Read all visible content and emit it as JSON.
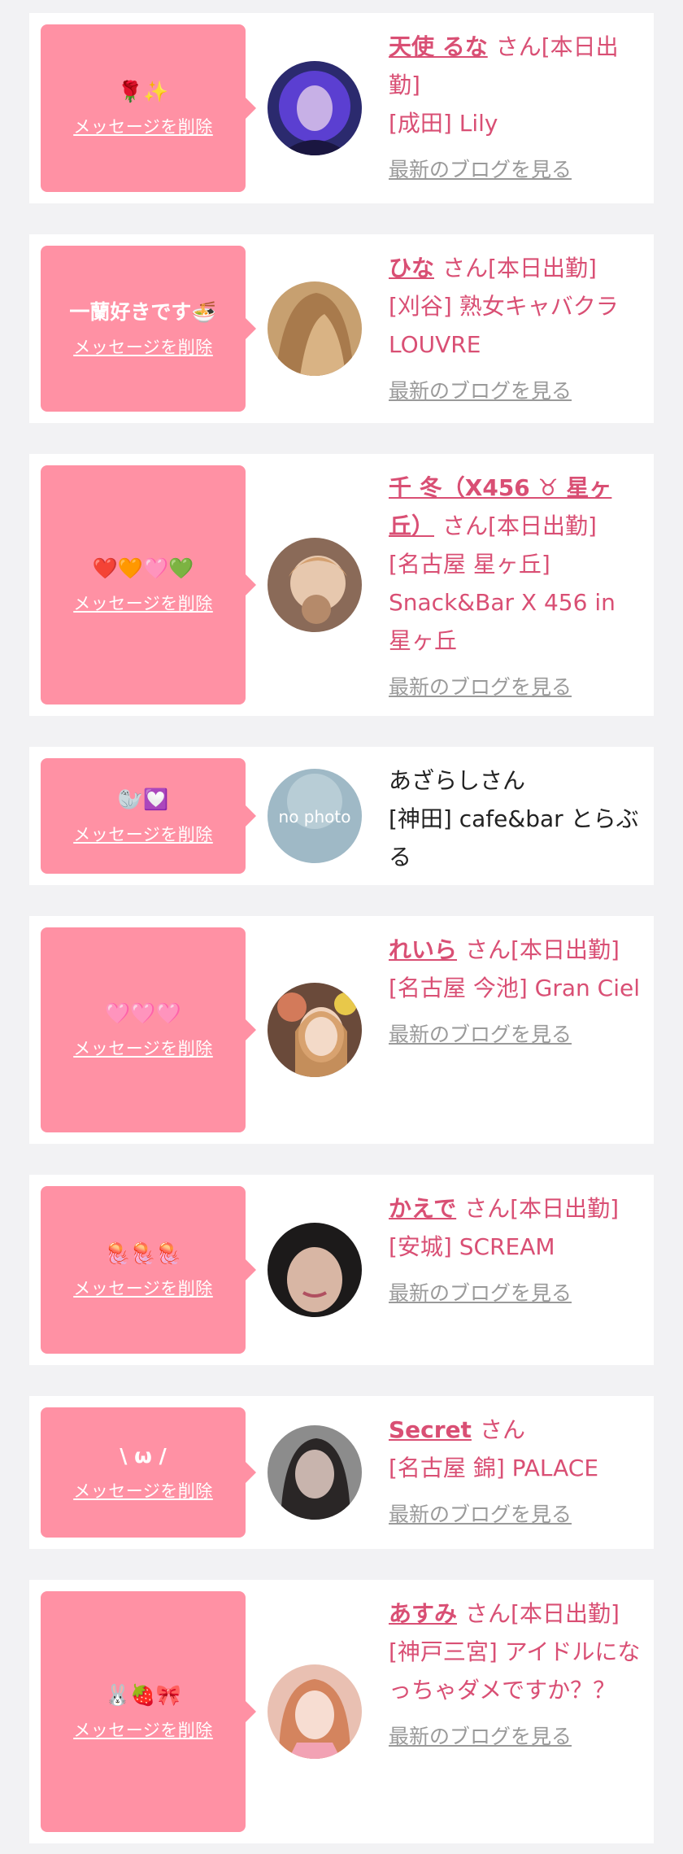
{
  "delete_label": "メッセージを削除",
  "blog_label": "最新のブログを見る",
  "items": [
    {
      "message": "🌹✨",
      "name": "天使 るな",
      "suffix": "さん[本日出勤]",
      "shop": "[成田] Lily"
    },
    {
      "message": "一蘭好きです🍜",
      "name": "ひな",
      "suffix": "さん[本日出勤]",
      "shop": "[刈谷] 熟女キャバクラ LOUVRE"
    },
    {
      "message": "❤️🧡🩷💚",
      "name": "千 冬（X456 ♉ 星ヶ丘）",
      "suffix": "さん[本日出勤]",
      "shop": "[名古屋 星ヶ丘] Snack&Bar X 456 in 星ヶ丘"
    },
    {
      "message": "🦭💟",
      "name": "あざらし",
      "suffix": "さん",
      "shop": "[神田] cafe&bar とらぶる"
    },
    {
      "message": "🩷🩷🩷",
      "name": "れいら",
      "suffix": "さん[本日出勤]",
      "shop": "[名古屋 今池] Gran Ciel"
    },
    {
      "message": "🪼🪼🪼",
      "name": "かえで",
      "suffix": "さん[本日出勤]",
      "shop": "[安城] SCREAM"
    },
    {
      "message": "\\ ω /",
      "name": "Secret",
      "suffix": "さん",
      "shop": "[名古屋 錦] PALACE"
    },
    {
      "message": "🐰🍓🎀",
      "name": "あすみ",
      "suffix": "さん[本日出勤]",
      "shop": "[神戸三宮] アイドルになっちゃダメですか？？"
    }
  ],
  "no_photo_label": "no photo",
  "colors": {
    "bubble": "#ff91a4",
    "accent": "#d94f74",
    "muted": "#9a9a9a"
  }
}
